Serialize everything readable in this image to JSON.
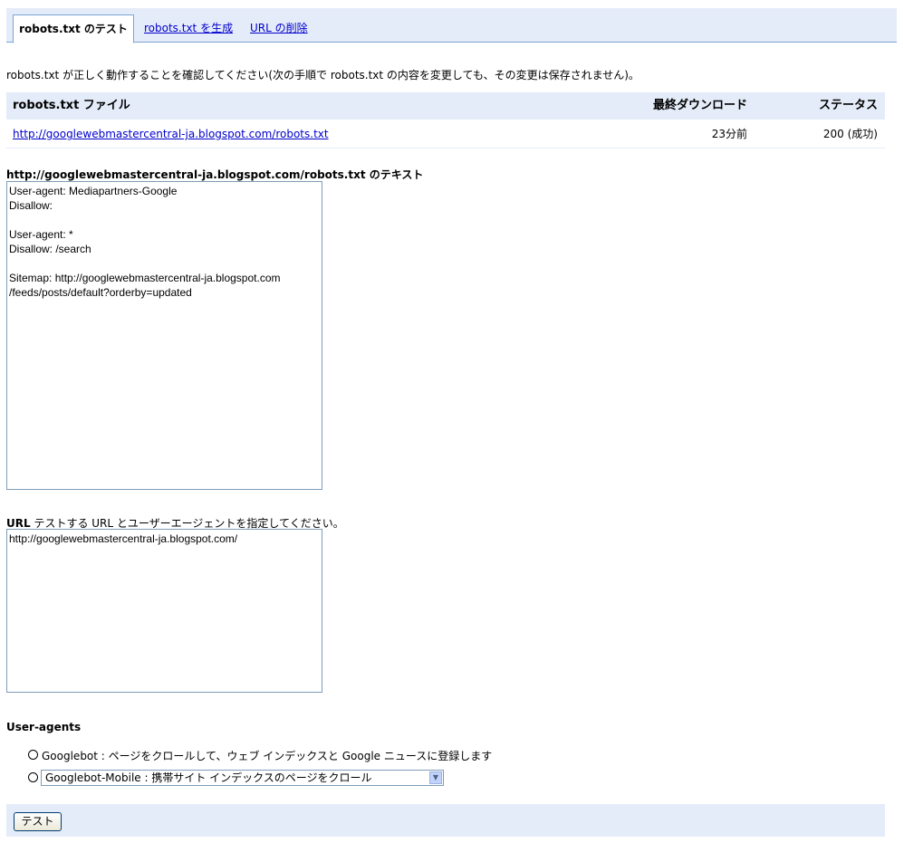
{
  "tabs": [
    {
      "label": "robots.txt のテスト",
      "active": true
    },
    {
      "label": "robots.txt を生成",
      "active": false
    },
    {
      "label": "URL の削除",
      "active": false
    }
  ],
  "intro": "robots.txt が正しく動作することを確認してください(次の手順で robots.txt の内容を変更しても、その変更は保存されません)。",
  "table": {
    "headers": [
      "robots.txt ファイル",
      "最終ダウンロード",
      "ステータス"
    ],
    "row": {
      "file": "http://googlewebmastercentral-ja.blogspot.com/robots.txt",
      "downloaded": "23分前",
      "status": "200 (成功)"
    }
  },
  "robots_text": {
    "label": "http://googlewebmastercentral-ja.blogspot.com/robots.txt のテキスト",
    "content": "User-agent: Mediapartners-Google\nDisallow:\n\nUser-agent: *\nDisallow: /search\n\nSitemap: http://googlewebmastercentral-ja.blogspot.com\n/feeds/posts/default?orderby=updated"
  },
  "url_test": {
    "label_bold": "URL",
    "label_rest": " テストする URL とユーザーエージェントを指定してください。",
    "content": "http://googlewebmastercentral-ja.blogspot.com/"
  },
  "user_agents": {
    "title": "User-agents",
    "option1": "Googlebot : ページをクロールして、ウェブ インデックスと Google ニュースに登録します",
    "option2_selected": "Googlebot-Mobile : 携帯サイト インデックスのページをクロール"
  },
  "test_button": "テスト"
}
